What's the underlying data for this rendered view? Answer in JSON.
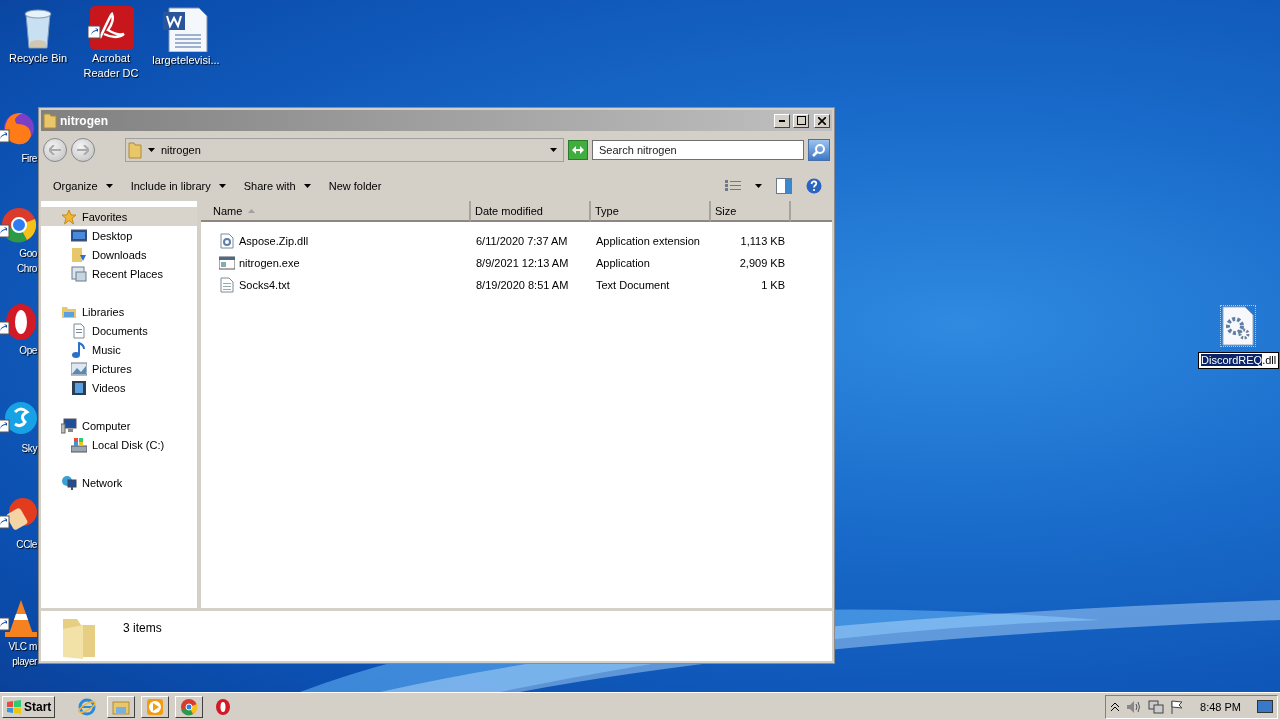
{
  "desktop_icons": [
    {
      "kind": "recycle",
      "lines": [
        "Recycle Bin"
      ],
      "shortcut": false,
      "selected": false
    },
    {
      "kind": "pdf",
      "lines": [
        "Acrobat",
        "Reader DC"
      ],
      "shortcut": true,
      "selected": false
    },
    {
      "kind": "word",
      "lines": [
        "largetelevisi..."
      ],
      "shortcut": false,
      "selected": false
    },
    {
      "kind": "firefox",
      "lines": [
        "Fire"
      ],
      "shortcut": true,
      "selected": false
    },
    {
      "kind": "chrome",
      "lines": [
        "Goo",
        "Chro"
      ],
      "shortcut": true,
      "selected": false
    },
    {
      "kind": "opera",
      "lines": [
        "Ope"
      ],
      "shortcut": true,
      "selected": false
    },
    {
      "kind": "skype",
      "lines": [
        "Sky"
      ],
      "shortcut": true,
      "selected": false
    },
    {
      "kind": "ccleaner",
      "lines": [
        "CCle"
      ],
      "shortcut": true,
      "selected": false
    },
    {
      "kind": "vlc",
      "lines": [
        "VLC m",
        "player"
      ],
      "shortcut": true,
      "selected": false
    },
    {
      "kind": "dll",
      "shortcut": false,
      "selected": true
    }
  ],
  "rename_field": {
    "selected_text": "DiscordREQ",
    "rest_text": ".dll"
  },
  "window": {
    "title": "nitrogen",
    "address": {
      "path": "nitrogen"
    },
    "search": {
      "placeholder": "Search nitrogen"
    },
    "commands": [
      {
        "label": "Organize",
        "dropdown": true
      },
      {
        "label": "Include in library",
        "dropdown": true
      },
      {
        "label": "Share with",
        "dropdown": true
      },
      {
        "label": "New folder",
        "dropdown": false
      }
    ],
    "nav": [
      {
        "label": "Favorites",
        "kind": "favorites",
        "selected": true,
        "children": [
          {
            "label": "Desktop",
            "kind": "desktop",
            "selected": false
          },
          {
            "label": "Downloads",
            "kind": "downloads",
            "selected": false
          },
          {
            "label": "Recent Places",
            "kind": "recent",
            "selected": false
          }
        ]
      },
      {
        "label": "Libraries",
        "kind": "libraries",
        "selected": false,
        "children": [
          {
            "label": "Documents",
            "kind": "documents",
            "selected": false
          },
          {
            "label": "Music",
            "kind": "music",
            "selected": false
          },
          {
            "label": "Pictures",
            "kind": "pictures",
            "selected": false
          },
          {
            "label": "Videos",
            "kind": "videos",
            "selected": false
          }
        ]
      },
      {
        "label": "Computer",
        "kind": "computer",
        "selected": false,
        "children": [
          {
            "label": "Local Disk (C:)",
            "kind": "disk",
            "selected": false
          }
        ]
      },
      {
        "label": "Network",
        "kind": "network",
        "selected": false
      }
    ],
    "columns": [
      {
        "label": "Name",
        "sorted": true
      },
      {
        "label": "Date modified",
        "sorted": false
      },
      {
        "label": "Type",
        "sorted": false
      },
      {
        "label": "Size",
        "sorted": false
      }
    ],
    "files": [
      {
        "kind": "dll",
        "name": "Aspose.Zip.dll",
        "date": "6/11/2020 7:37 AM",
        "type": "Application extension",
        "size": "1,113 KB"
      },
      {
        "kind": "exe",
        "name": "nitrogen.exe",
        "date": "8/9/2021 12:13 AM",
        "type": "Application",
        "size": "2,909 KB"
      },
      {
        "kind": "txt",
        "name": "Socks4.txt",
        "date": "8/19/2020 8:51 AM",
        "type": "Text Document",
        "size": "1 KB"
      }
    ],
    "status": "3 items"
  },
  "taskbar": {
    "start": "Start",
    "apps": [
      {
        "kind": "ie",
        "running": false
      },
      {
        "kind": "explorer",
        "running": true
      },
      {
        "kind": "media",
        "running": true
      },
      {
        "kind": "chrome",
        "running": true
      },
      {
        "kind": "opera",
        "running": false
      }
    ],
    "clock": "8:48 PM"
  }
}
